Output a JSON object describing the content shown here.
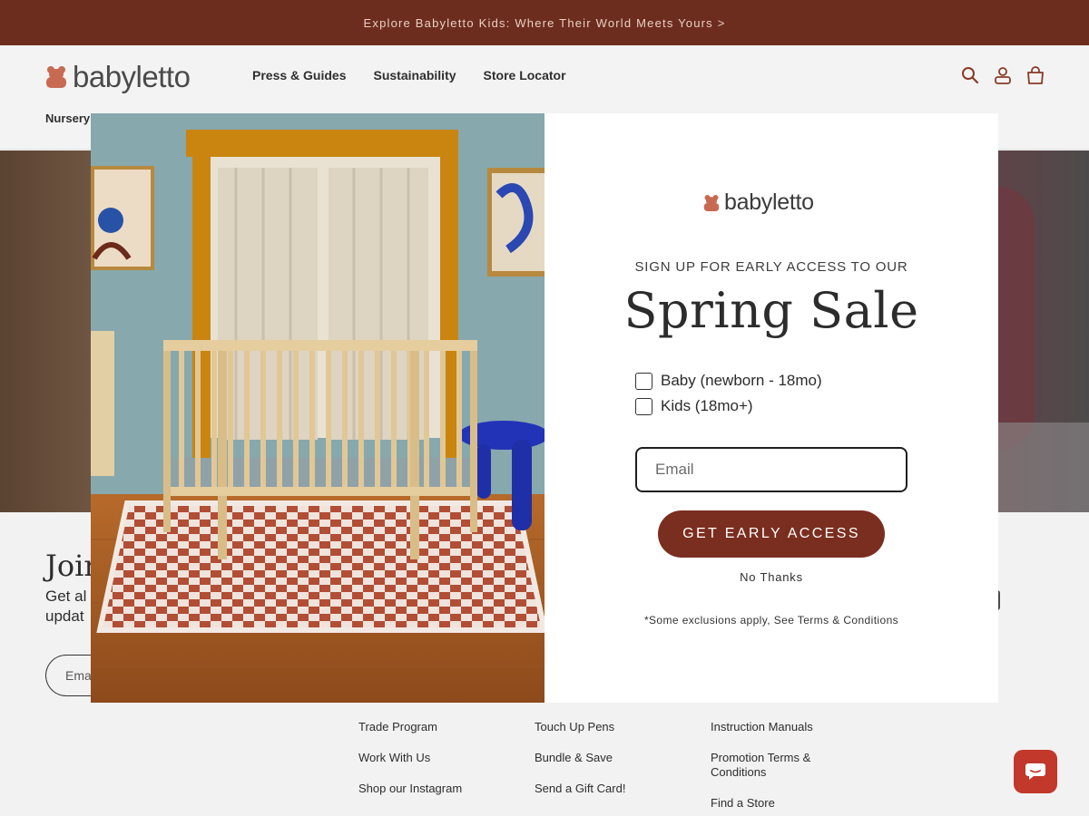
{
  "announcement": "Explore Babyletto Kids: Where Their World Meets Yours >",
  "header": {
    "logo_text": "babyletto",
    "nav": [
      "Press & Guides",
      "Sustainability",
      "Store Locator"
    ],
    "nursery_label": "Nursery"
  },
  "footer": {
    "join_title": "Join",
    "join_sub_line1": "Get al",
    "join_sub_line2": "updat",
    "email_placeholder": "Ema",
    "col1": [
      "Trade Program",
      "Work With Us",
      "Shop our Instagram"
    ],
    "col2": [
      "Touch Up Pens",
      "Bundle & Save",
      "Send a Gift Card!"
    ],
    "col3": {
      "a": "Instruction Manuals",
      "b_line1": "Promotion Terms &",
      "b_line2": "Conditions",
      "c": "Find a Store"
    }
  },
  "modal": {
    "logo_text": "babyletto",
    "kicker": "SIGN UP FOR EARLY ACCESS TO OUR",
    "title": "Spring Sale",
    "options": [
      "Baby (newborn - 18mo)",
      "Kids (18mo+)"
    ],
    "email_placeholder": "Email",
    "cta": "GET EARLY ACCESS",
    "dismiss": "No Thanks",
    "terms_prefix": "*Some exclusions apply, ",
    "terms_link": "See Terms & Conditions"
  },
  "colors": {
    "announcement_bg": "#6d2d1e",
    "brand_cta": "#7a2e1f",
    "logo_bear": "#c86a52",
    "chat": "#c2382b"
  },
  "icons": [
    "bear-logo-icon",
    "search-icon",
    "account-icon",
    "cart-icon",
    "chat-icon"
  ]
}
